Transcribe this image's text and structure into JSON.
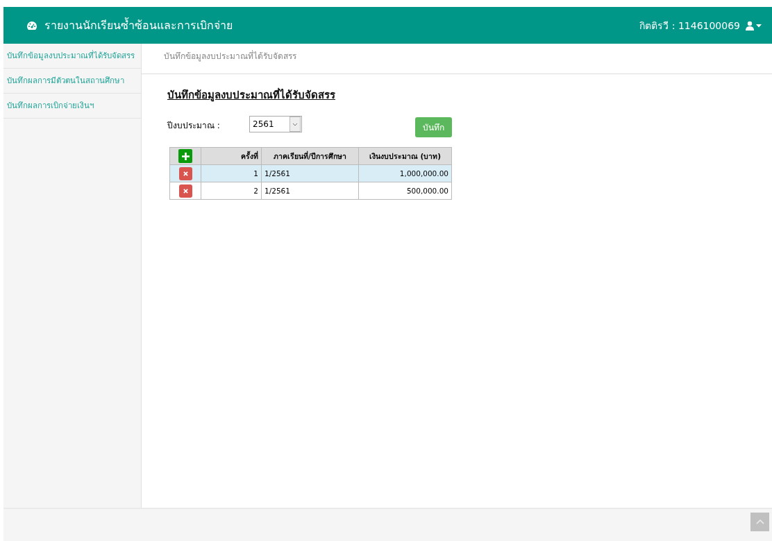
{
  "header": {
    "title": "รายงานนักเรียนซ้ำซ้อนและการเบิกจ่าย",
    "user": "กิตติรวี : 1146100069"
  },
  "sidebar": {
    "items": [
      {
        "label": "บันทึกข้อมูลงบประมาณที่ได้รับจัดสรร"
      },
      {
        "label": "บันทึกผลการมีตัวตนในสถานศึกษา"
      },
      {
        "label": "บันทึกผลการเบิกจ่ายเงินฯ"
      }
    ]
  },
  "breadcrumb": "บันทึกข้อมูลงบประมาณที่ได้รับจัดสรร",
  "form": {
    "heading": "บันทึกข้อมูลงบประมาณที่ได้รับจัดสรร",
    "year_label": "ปีงบประมาณ :",
    "year_value": "2561",
    "save_button": "บันทึก"
  },
  "table": {
    "columns": [
      "ครั้งที่",
      "ภาคเรียนที่/ปีการศึกษา",
      "เงินงบประมาณ (บาท)"
    ],
    "rows": [
      {
        "cells": [
          "1",
          "1/2561",
          "1,000,000.00"
        ],
        "selected": true
      },
      {
        "cells": [
          "2",
          "1/2561",
          "500,000.00"
        ],
        "selected": false
      }
    ]
  }
}
